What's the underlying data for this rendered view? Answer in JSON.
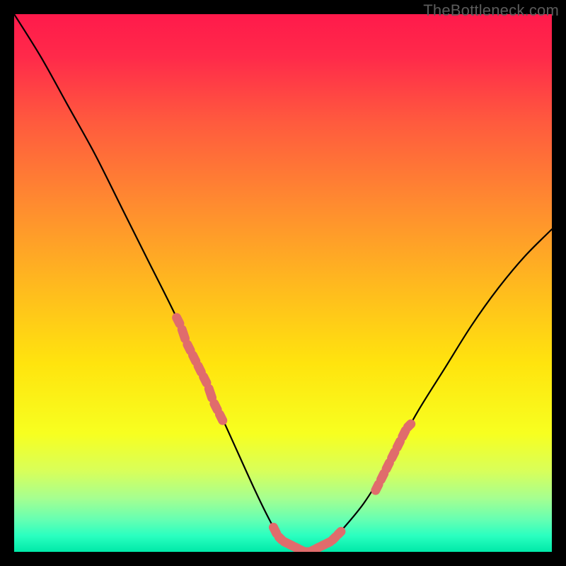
{
  "watermark": "TheBottleneck.com",
  "colors": {
    "frame": "#000000",
    "curve": "#000000",
    "marker": "#e06c6c",
    "gradient_stops": [
      {
        "offset": 0.0,
        "color": "#ff1a4b"
      },
      {
        "offset": 0.08,
        "color": "#ff2a4a"
      },
      {
        "offset": 0.2,
        "color": "#ff5a3e"
      },
      {
        "offset": 0.35,
        "color": "#ff8a30"
      },
      {
        "offset": 0.5,
        "color": "#ffb81f"
      },
      {
        "offset": 0.65,
        "color": "#ffe40e"
      },
      {
        "offset": 0.78,
        "color": "#f7ff20"
      },
      {
        "offset": 0.85,
        "color": "#d8ff5a"
      },
      {
        "offset": 0.9,
        "color": "#a6ff90"
      },
      {
        "offset": 0.94,
        "color": "#66ffb2"
      },
      {
        "offset": 0.97,
        "color": "#2affc0"
      },
      {
        "offset": 1.0,
        "color": "#00e9a8"
      }
    ]
  },
  "chart_data": {
    "type": "line",
    "title": "",
    "xlabel": "",
    "ylabel": "",
    "xlim": [
      0,
      100
    ],
    "ylim": [
      0,
      100
    ],
    "grid": false,
    "series": [
      {
        "name": "bottleneck-curve",
        "x": [
          0,
          5,
          10,
          15,
          20,
          25,
          30,
          35,
          40,
          45,
          48,
          50,
          52,
          54,
          56,
          58,
          60,
          65,
          70,
          75,
          80,
          85,
          90,
          95,
          100
        ],
        "y": [
          100,
          92,
          83,
          74,
          64,
          54,
          44,
          33,
          22,
          11,
          5,
          2,
          1,
          0,
          0,
          1,
          3,
          9,
          17,
          26,
          34,
          42,
          49,
          55,
          60
        ]
      }
    ],
    "marker_clusters": [
      {
        "name": "left-shoulder",
        "points": [
          {
            "x": 30,
            "y": 44
          },
          {
            "x": 31,
            "y": 42
          },
          {
            "x": 32,
            "y": 39
          },
          {
            "x": 33,
            "y": 37
          },
          {
            "x": 34,
            "y": 35
          },
          {
            "x": 35,
            "y": 33
          },
          {
            "x": 36,
            "y": 31
          },
          {
            "x": 37,
            "y": 28
          },
          {
            "x": 38,
            "y": 26
          },
          {
            "x": 39,
            "y": 24
          }
        ]
      },
      {
        "name": "valley-floor",
        "points": [
          {
            "x": 48,
            "y": 5
          },
          {
            "x": 49,
            "y": 3
          },
          {
            "x": 50,
            "y": 2
          },
          {
            "x": 51,
            "y": 1.5
          },
          {
            "x": 52,
            "y": 1
          },
          {
            "x": 53,
            "y": 0.5
          },
          {
            "x": 54,
            "y": 0
          },
          {
            "x": 55,
            "y": 0
          },
          {
            "x": 56,
            "y": 0.5
          },
          {
            "x": 57,
            "y": 1
          },
          {
            "x": 58,
            "y": 1.5
          },
          {
            "x": 59,
            "y": 2
          },
          {
            "x": 60,
            "y": 3
          },
          {
            "x": 61,
            "y": 4
          }
        ]
      },
      {
        "name": "right-shoulder",
        "points": [
          {
            "x": 67,
            "y": 11
          },
          {
            "x": 68,
            "y": 13
          },
          {
            "x": 69,
            "y": 15
          },
          {
            "x": 70,
            "y": 17
          },
          {
            "x": 71,
            "y": 19
          },
          {
            "x": 72,
            "y": 21
          },
          {
            "x": 73,
            "y": 23
          },
          {
            "x": 74,
            "y": 24
          }
        ]
      }
    ]
  }
}
